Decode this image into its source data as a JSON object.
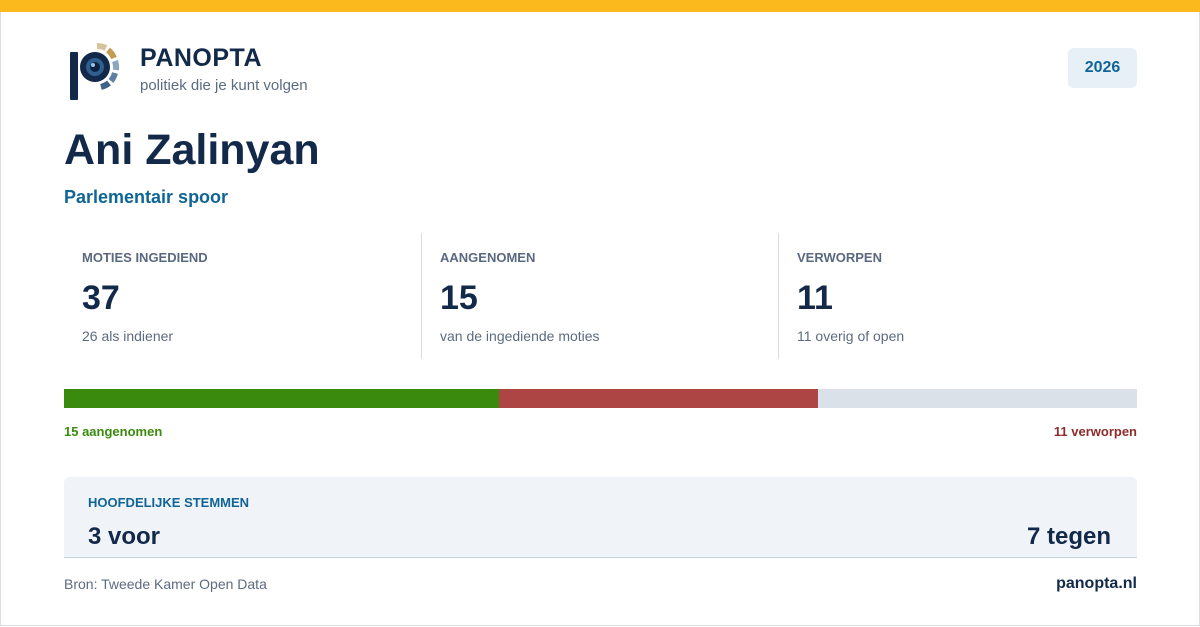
{
  "brand": {
    "name": "PANOPTA",
    "tagline": "politiek die je kunt volgen",
    "year": "2026",
    "colors": {
      "accent": "#fbb91d",
      "primary": "#12294a",
      "link": "#0f6596"
    }
  },
  "person": {
    "name": "Ani Zalinyan",
    "track": "Parlementair spoor"
  },
  "stats": [
    {
      "label": "MOTIES INGEDIEND",
      "value": "37",
      "note": "26 als indiener"
    },
    {
      "label": "AANGENOMEN",
      "value": "15",
      "note": "van de ingediende moties"
    },
    {
      "label": "VERWORPEN",
      "value": "11",
      "note": "11 overig of open"
    }
  ],
  "progress": {
    "total": 37,
    "segments": [
      {
        "name": "aangenomen",
        "count": 15,
        "color": "#3a8a0e"
      },
      {
        "name": "verworpen",
        "count": 11,
        "color": "#ad4545"
      }
    ],
    "remainder_color": "#dbe1e8",
    "legend_left": "15 aangenomen",
    "legend_right": "11 verworpen"
  },
  "votes": {
    "title": "HOOFDELIJKE STEMMEN",
    "for": "3 voor",
    "against": "7 tegen"
  },
  "footer": {
    "source": "Bron: Tweede Kamer Open Data",
    "site": "panopta.nl"
  }
}
